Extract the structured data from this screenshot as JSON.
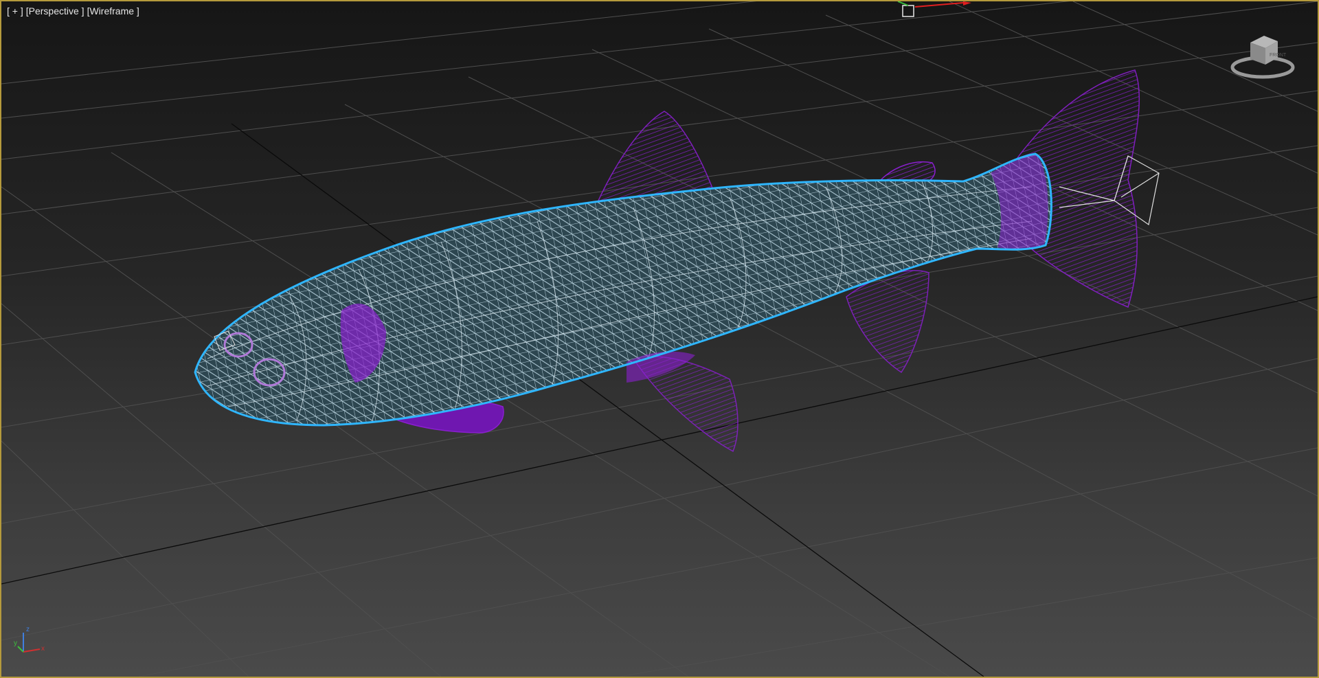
{
  "viewport": {
    "labels": [
      {
        "id": "plus",
        "text": "[ + ]"
      },
      {
        "id": "view",
        "text": "[Perspective ]"
      },
      {
        "id": "shading",
        "text": "[Wireframe ]"
      }
    ],
    "axis": {
      "z": "z",
      "x": "x",
      "y": "y"
    },
    "colors": {
      "border": "#b59a3c",
      "mesh": "#cfe9f5",
      "selection": "#2fb6ff",
      "fins": "#8a1fcf",
      "grid": "#4f4f4f",
      "grid_major": "#0a0a0a"
    },
    "icons": [
      "viewcube-icon",
      "axis-tripod-icon",
      "move-gizmo-icon"
    ]
  }
}
